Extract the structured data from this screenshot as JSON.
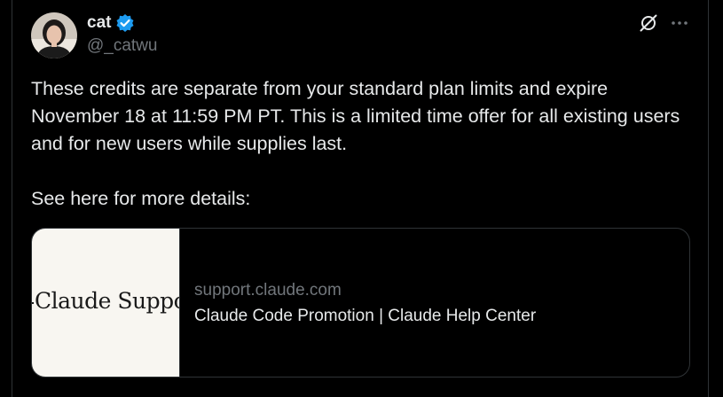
{
  "author": {
    "display_name": "cat",
    "handle": "@_catwu",
    "verified": true
  },
  "icons": {
    "verified": "verified-badge-icon",
    "grok": "grok-icon",
    "more": "more-horizontal-icon"
  },
  "tweet": {
    "paragraphs": [
      "These credits are separate from your standard plan limits and expire November 18 at 11:59 PM PT. This is a limited time offer for all existing users and for new users while supplies last.",
      "See here for more details:"
    ]
  },
  "link_card": {
    "thumbnail_text": "Claude Suppo",
    "domain": "support.claude.com",
    "title": "Claude Code Promotion | Claude Help Center"
  },
  "colors": {
    "background": "#000000",
    "text_primary": "#e7e9ea",
    "text_secondary": "#71767b",
    "border": "#2f3336",
    "verified_blue": "#1d9bf0",
    "thumbnail_bg": "#f8f6f1"
  }
}
